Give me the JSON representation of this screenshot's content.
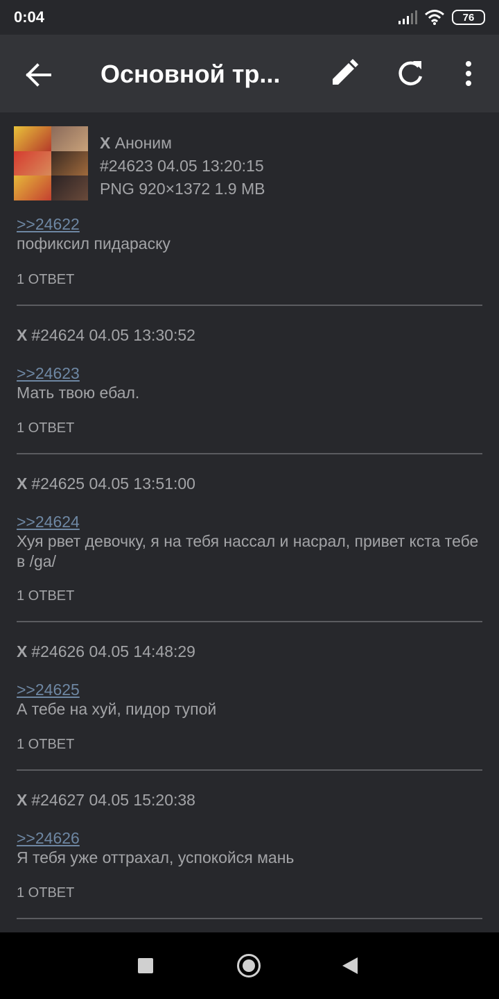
{
  "status": {
    "time": "0:04",
    "battery": "76"
  },
  "header": {
    "title": "Основной тр..."
  },
  "first_post": {
    "author_mark": "X",
    "author": "Аноним",
    "number": "#24623",
    "datetime": "04.05 13:20:15",
    "file_info": "PNG 920×1372 1.9 MB",
    "reply_to": ">>24622",
    "text": "пофиксил пидараску",
    "replies": "1 ОТВЕТ"
  },
  "posts": [
    {
      "mark": "X",
      "number": "#24624",
      "datetime": "04.05 13:30:52",
      "reply_to": ">>24623",
      "text": "Мать твою ебал.",
      "replies": "1 ОТВЕТ"
    },
    {
      "mark": "X",
      "number": "#24625",
      "datetime": "04.05 13:51:00",
      "reply_to": ">>24624",
      "text": "Хуя рвет девочку, я на тебя нассал и насрал, привет кста тебе в /ga/",
      "replies": "1 ОТВЕТ"
    },
    {
      "mark": "X",
      "number": "#24626",
      "datetime": "04.05 14:48:29",
      "reply_to": ">>24625",
      "text": "А тебе на хуй, пидор тупой",
      "replies": "1 ОТВЕТ"
    },
    {
      "mark": "X",
      "number": "#24627",
      "datetime": "04.05 15:20:38",
      "reply_to": ">>24626",
      "text": "Я тебя уже оттрахал, успокойся мань",
      "replies": "1 ОТВЕТ"
    }
  ],
  "colors": {
    "background": "#27282c",
    "app_bar": "#333438",
    "link": "#6e87a3",
    "text": "#a3a4a7"
  }
}
